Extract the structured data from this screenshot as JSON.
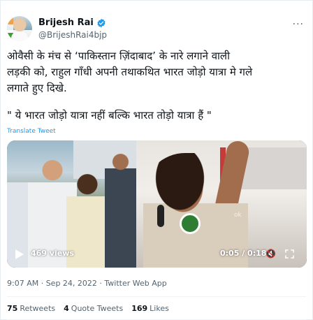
{
  "author": {
    "display_name": "Brijesh Rai",
    "handle": "@BrijeshRai4bjp",
    "verified_icon": "verified-badge-icon",
    "verified_color": "#1d9bf0"
  },
  "tweet": {
    "line1": "ओवैसी के मंच से ‘पाकिस्तान ज़िंदाबाद’ के नारे लगाने वाली",
    "line2": "लड़की को, राहुल गाँधी अपनी तथाकथित भारत जोड़ो यात्रा मे गले",
    "line3": "लगाते हुए दिखे.",
    "line4": "\" ये भारत जोड़ो यात्रा नहीं बल्कि भारत तोड़ो यात्रा हैं \"",
    "translate_label": "Translate Tweet"
  },
  "media": {
    "views": "469 views",
    "timer": "0:05 / 0:18",
    "watermark": "ok"
  },
  "meta": {
    "timestamp": "9:07 AM · Sep 24, 2022 · Twitter Web App"
  },
  "stats": {
    "retweets_count": "75",
    "retweets_label": "Retweets",
    "quotes_count": "4",
    "quotes_label": "Quote Tweets",
    "likes_count": "169",
    "likes_label": "Likes"
  },
  "colors": {
    "link": "#1d9bf0",
    "secondary_text": "#536471"
  }
}
